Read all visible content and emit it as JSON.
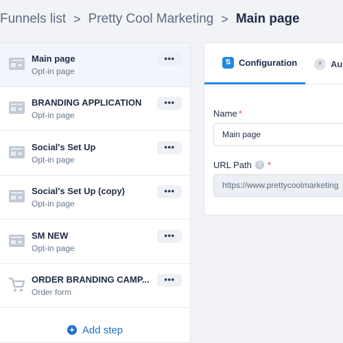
{
  "breadcrumb": {
    "items": [
      "Funnels list",
      "Pretty Cool Marketing",
      "Main page"
    ],
    "separator": ">"
  },
  "steps": [
    {
      "title": "Main page",
      "subtitle": "Opt-in page",
      "icon": "page-icon",
      "more": "•••"
    },
    {
      "title": "BRANDING APPLICATION",
      "subtitle": "Opt-in page",
      "icon": "page-icon",
      "more": "•••"
    },
    {
      "title": "Social's Set Up",
      "subtitle": "Opt-in page",
      "icon": "page-icon",
      "more": "•••"
    },
    {
      "title": "Social's Set Up (copy)",
      "subtitle": "Opt-in page",
      "icon": "page-icon",
      "more": "•••"
    },
    {
      "title": "SM NEW",
      "subtitle": "Opt-in page",
      "icon": "page-icon",
      "more": "•••"
    },
    {
      "title": "ORDER BRANDING CAMP...",
      "subtitle": "Order form",
      "icon": "cart-icon",
      "more": "•••"
    }
  ],
  "add_step": {
    "label": "Add step",
    "icon": "plus-circle-icon"
  },
  "tabs": [
    {
      "label": "Configuration",
      "icon": "sliders-icon",
      "active": true
    },
    {
      "label": "Au",
      "icon": "lightning-icon",
      "active": false
    }
  ],
  "form": {
    "name_label": "Name",
    "name_value": "Main page",
    "url_label": "URL Path",
    "url_value": "https://www.prettycoolmarketing",
    "required_mark": "*",
    "help_glyph": "?"
  },
  "colors": {
    "accent": "#1f88e5",
    "link": "#1f6fc6",
    "required": "#e0464b",
    "active_step_bg": "#f2f6fc"
  }
}
